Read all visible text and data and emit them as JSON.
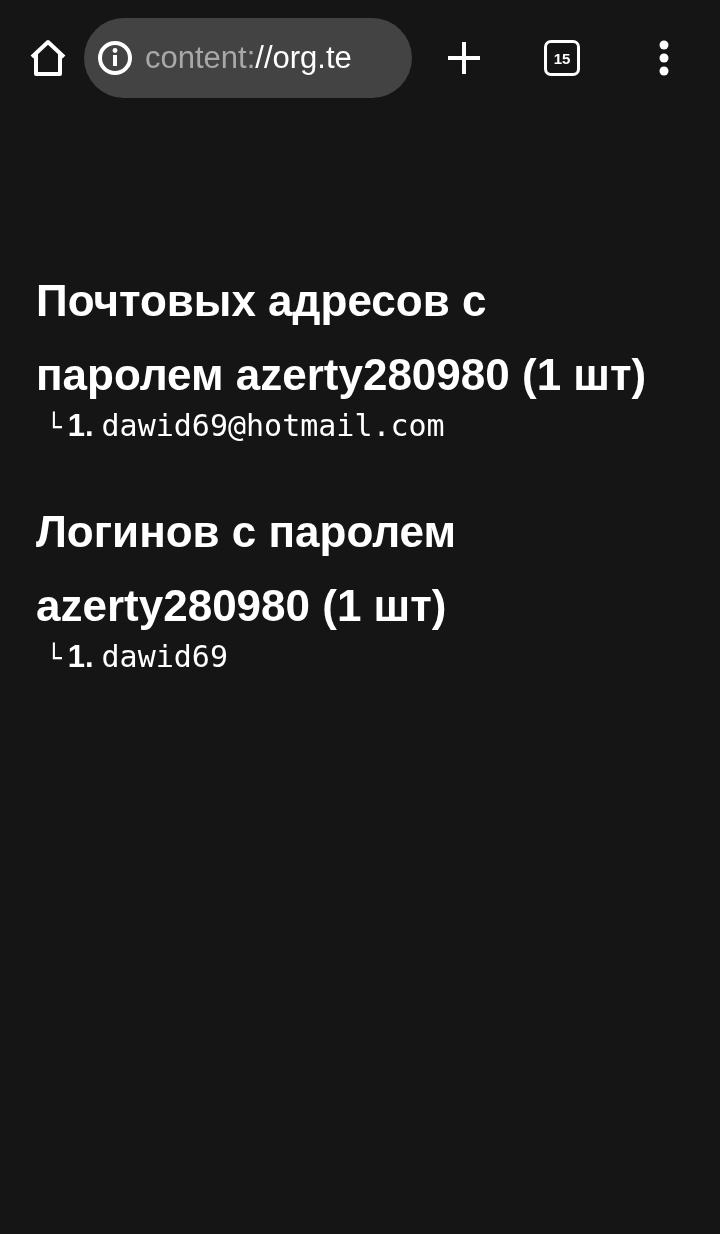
{
  "toolbar": {
    "url_scheme": "content:",
    "url_rest": "//org.te",
    "tab_count": "15"
  },
  "sections": [
    {
      "heading": "Почтовых адресов с паролем azerty280980 (1 шт)",
      "items": [
        {
          "branch": "└",
          "number": "1.",
          "value": "dawid69@hotmail.com"
        }
      ]
    },
    {
      "heading": "Логинов с паролем azerty280980 (1 шт)",
      "items": [
        {
          "branch": "└",
          "number": "1.",
          "value": "dawid69"
        }
      ]
    }
  ]
}
